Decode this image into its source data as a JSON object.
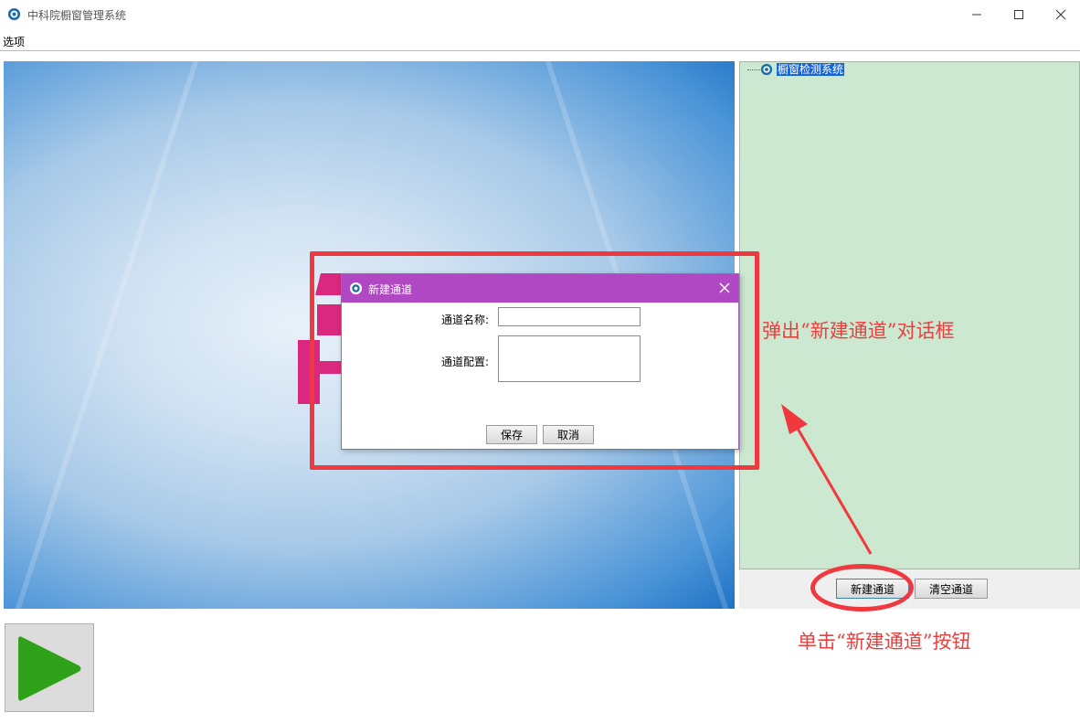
{
  "window": {
    "title": "中科院橱窗管理系统"
  },
  "menu": {
    "options_label": "选项"
  },
  "tree": {
    "root_label": "橱窗检测系统"
  },
  "buttons": {
    "new_channel": "新建通道",
    "clear_channels": "清空通道"
  },
  "dialog": {
    "title": "新建通道",
    "name_label": "通道名称:",
    "name_value": "",
    "config_label": "通道配置:",
    "config_value": "",
    "save_label": "保存",
    "cancel_label": "取消"
  },
  "annotations": {
    "popup_note": "弹出“新建通道”对话框",
    "click_note": "单击“新建通道”按钮"
  },
  "colors": {
    "dialog_titlebar": "#b048c4",
    "tree_background": "#cde8d0",
    "annotation_red": "#f0383f",
    "play_green": "#2fa11a"
  },
  "icons": {
    "app": "gear-logo-icon",
    "play": "play-icon",
    "close": "close-icon"
  }
}
